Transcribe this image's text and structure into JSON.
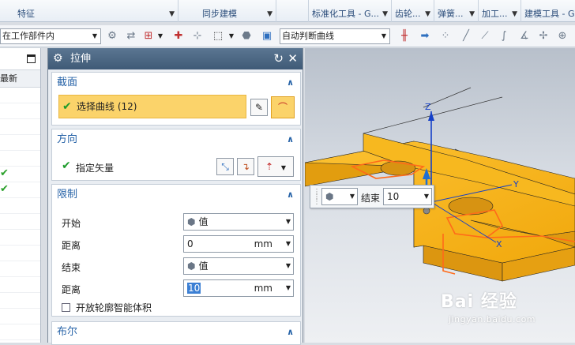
{
  "ribbon": {
    "groups": [
      {
        "label": "特征",
        "dropdown": true
      },
      {
        "label": "同步建模",
        "dropdown": true
      },
      {
        "label": "标准化工具 - G...",
        "dropdown": true
      },
      {
        "label": "齿轮...",
        "dropdown": true
      },
      {
        "label": "弹簧...",
        "dropdown": true
      },
      {
        "label": "加工...",
        "dropdown": true
      },
      {
        "label": "建模工具 - G...",
        "dropdown": true
      }
    ]
  },
  "toolbar": {
    "scope_value": "在工作部件内",
    "curve_rule_value": "自动判断曲线"
  },
  "navigator": {
    "column_header": "最新",
    "checked_rows": [
      6,
      7
    ]
  },
  "dialog": {
    "title": "拉伸",
    "section": {
      "title": "截面",
      "select_curve_label": "选择曲线 (12)"
    },
    "direction": {
      "title": "方向",
      "specify_vector_label": "指定矢量"
    },
    "limits": {
      "title": "限制",
      "start_label": "开始",
      "start_value": "值",
      "start_distance_label": "距离",
      "start_distance_value": "0",
      "start_unit": "mm",
      "end_label": "结束",
      "end_value": "值",
      "end_distance_label": "距离",
      "end_distance_value": "10",
      "end_unit": "mm",
      "open_profile_label": "开放轮廓智能体积"
    },
    "boolean": {
      "title": "布尔"
    }
  },
  "viewport": {
    "float_bar": {
      "label": "结束",
      "value": "10"
    },
    "axes": {
      "x": "X",
      "y": "Y",
      "z": "Z"
    },
    "model_color": "#f5b316",
    "watermark": "Bai 经验",
    "watermark_url": "jingyan.baidu.com"
  }
}
